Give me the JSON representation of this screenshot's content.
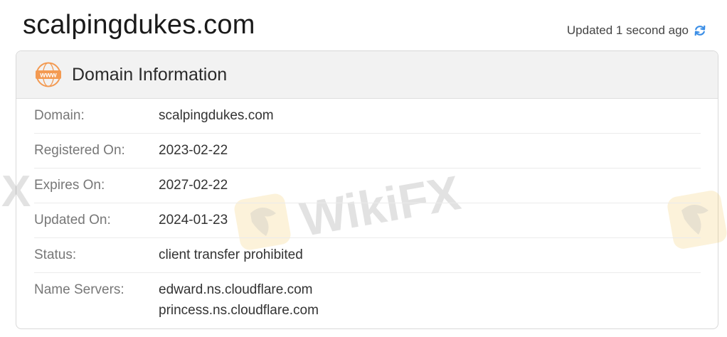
{
  "header": {
    "domain_title": "scalpingdukes.com",
    "updated_text": "Updated 1 second ago",
    "refresh_icon": "refresh-icon",
    "accent_color": "#3b8ee6"
  },
  "card": {
    "title": "Domain Information",
    "icon": "www-icon",
    "icon_text": "www",
    "icon_color": "#f39a52",
    "rows": [
      {
        "label": "Domain:",
        "value": "scalpingdukes.com"
      },
      {
        "label": "Registered On:",
        "value": "2023-02-22"
      },
      {
        "label": "Expires On:",
        "value": "2027-02-22"
      },
      {
        "label": "Updated On:",
        "value": "2024-01-23"
      },
      {
        "label": "Status:",
        "value": "client transfer prohibited"
      },
      {
        "label": "Name Servers:",
        "values": [
          "edward.ns.cloudflare.com",
          "princess.ns.cloudflare.com"
        ]
      }
    ]
  },
  "watermark": {
    "text": "WikiFX",
    "fragment": "X"
  }
}
